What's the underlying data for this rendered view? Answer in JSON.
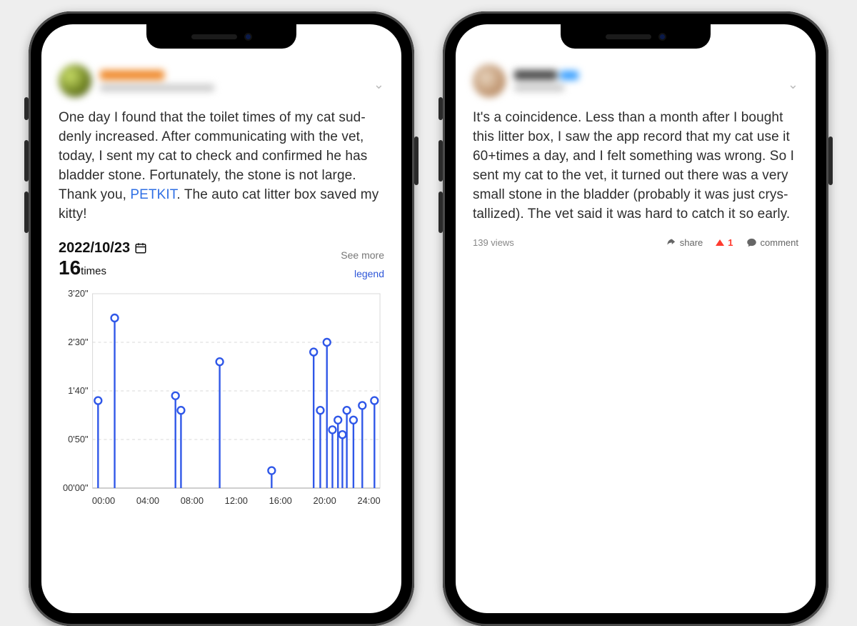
{
  "left": {
    "post_text_pre": "One day I found that the toilet times of my cat sud-\ndenly increased. After communicating with the vet,\ntoday, I sent my cat to check and confirmed he has\nbladder stone. Fortunately, the stone is not large.\nThank you, ",
    "brand": "PETKIT",
    "post_text_post": ". The auto cat litter box saved my\nkitty!",
    "chart_date": "2022/10/23",
    "times_number": "16",
    "times_unit": "times",
    "see_more": "See more",
    "legend": "legend"
  },
  "right": {
    "post_text": "It's a coincidence. Less than a month after I bought this litter box, I saw the app record that my cat use it 60+times a day, and I felt something was wrong. So I sent my cat to the vet, it turned out there was a very small stone in the bladder (probably it was just crys-\ntallized). The vet said it was hard to catch it so early.",
    "views": "139 views",
    "share": "share",
    "upvotes": "1",
    "comment": "comment"
  },
  "chart_data": {
    "type": "scatter",
    "title": "",
    "xlabel": "",
    "ylabel": "",
    "x_ticks": [
      "00:00",
      "04:00",
      "08:00",
      "12:00",
      "16:00",
      "20:00",
      "24:00"
    ],
    "y_ticks": [
      "00'00\"",
      "0'50\"",
      "1'40\"",
      "2'30\"",
      "3'20\""
    ],
    "y_unit": "seconds",
    "ylim_seconds": [
      0,
      200
    ],
    "xlim_hours": [
      -1,
      25
    ],
    "points": [
      {
        "hour": -0.5,
        "seconds": 90
      },
      {
        "hour": 1.0,
        "seconds": 175
      },
      {
        "hour": 6.5,
        "seconds": 95
      },
      {
        "hour": 7.0,
        "seconds": 80
      },
      {
        "hour": 10.5,
        "seconds": 130
      },
      {
        "hour": 15.2,
        "seconds": 18
      },
      {
        "hour": 19.0,
        "seconds": 140
      },
      {
        "hour": 19.6,
        "seconds": 80
      },
      {
        "hour": 20.2,
        "seconds": 150
      },
      {
        "hour": 20.7,
        "seconds": 60
      },
      {
        "hour": 21.2,
        "seconds": 70
      },
      {
        "hour": 21.6,
        "seconds": 55
      },
      {
        "hour": 22.0,
        "seconds": 80
      },
      {
        "hour": 22.6,
        "seconds": 70
      },
      {
        "hour": 23.4,
        "seconds": 85
      },
      {
        "hour": 24.5,
        "seconds": 90
      }
    ]
  }
}
